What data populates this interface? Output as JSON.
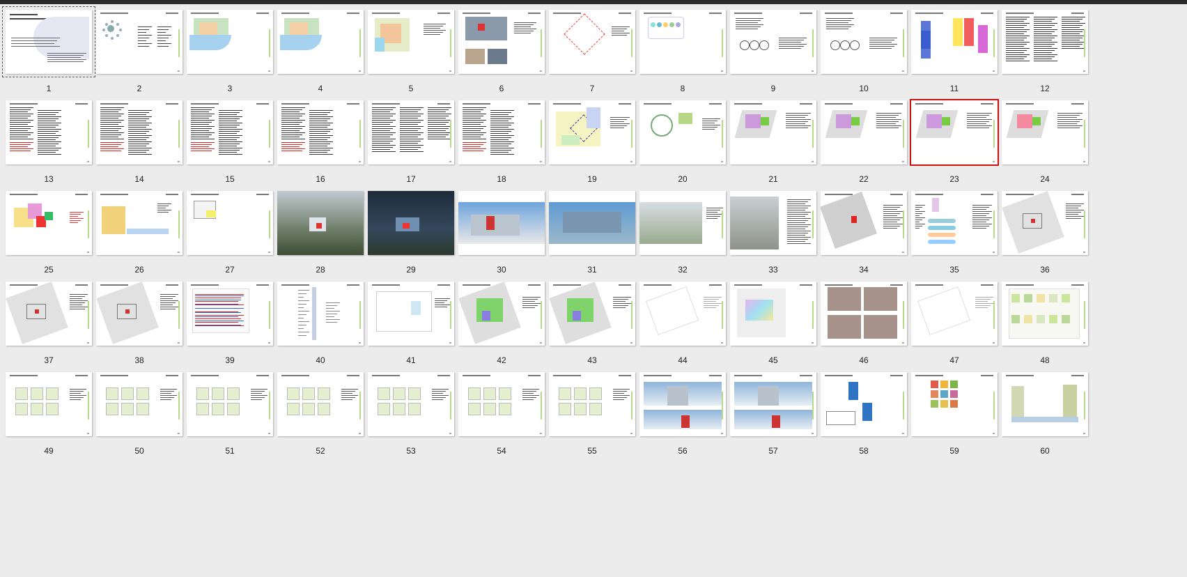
{
  "window": {
    "toolbar_color": "#2b2b2b",
    "background": "#ececec"
  },
  "selection": {
    "selected_slide": 23,
    "current_slide": 1,
    "selected_border_color": "#d01010"
  },
  "slides": [
    {
      "n": "1",
      "kind": "title"
    },
    {
      "n": "2",
      "kind": "hub"
    },
    {
      "n": "3",
      "kind": "map"
    },
    {
      "n": "4",
      "kind": "map2"
    },
    {
      "n": "5",
      "kind": "plan-color"
    },
    {
      "n": "6",
      "kind": "photos"
    },
    {
      "n": "7",
      "kind": "diamond"
    },
    {
      "n": "8",
      "kind": "circles"
    },
    {
      "n": "9",
      "kind": "diagram"
    },
    {
      "n": "10",
      "kind": "diagram"
    },
    {
      "n": "11",
      "kind": "flow"
    },
    {
      "n": "12",
      "kind": "text"
    },
    {
      "n": "13",
      "kind": "text-red"
    },
    {
      "n": "14",
      "kind": "text-red"
    },
    {
      "n": "15",
      "kind": "text-red"
    },
    {
      "n": "16",
      "kind": "text-red"
    },
    {
      "n": "17",
      "kind": "text"
    },
    {
      "n": "18",
      "kind": "text-red"
    },
    {
      "n": "19",
      "kind": "site"
    },
    {
      "n": "20",
      "kind": "circle-plan"
    },
    {
      "n": "21",
      "kind": "iso"
    },
    {
      "n": "22",
      "kind": "iso"
    },
    {
      "n": "23",
      "kind": "iso"
    },
    {
      "n": "24",
      "kind": "iso-pink"
    },
    {
      "n": "25",
      "kind": "massing"
    },
    {
      "n": "26",
      "kind": "elevation"
    },
    {
      "n": "27",
      "kind": "massing-light"
    },
    {
      "n": "28",
      "kind": "aerial"
    },
    {
      "n": "29",
      "kind": "aerial-dark"
    },
    {
      "n": "30",
      "kind": "render-blue"
    },
    {
      "n": "31",
      "kind": "render-glass"
    },
    {
      "n": "32",
      "kind": "render-site"
    },
    {
      "n": "33",
      "kind": "render-interior"
    },
    {
      "n": "34",
      "kind": "plan-selected"
    },
    {
      "n": "35",
      "kind": "pink-diagram"
    },
    {
      "n": "36",
      "kind": "plan-grey"
    },
    {
      "n": "37",
      "kind": "plan-grey"
    },
    {
      "n": "38",
      "kind": "plan-grey"
    },
    {
      "n": "39",
      "kind": "plan-redblue"
    },
    {
      "n": "40",
      "kind": "section"
    },
    {
      "n": "41",
      "kind": "plan-light"
    },
    {
      "n": "42",
      "kind": "plan-green"
    },
    {
      "n": "43",
      "kind": "plan-green"
    },
    {
      "n": "44",
      "kind": "plan-faint"
    },
    {
      "n": "45",
      "kind": "plan-pastel"
    },
    {
      "n": "46",
      "kind": "photos-brown"
    },
    {
      "n": "47",
      "kind": "plan-faint"
    },
    {
      "n": "48",
      "kind": "plan-colorful"
    },
    {
      "n": "49",
      "kind": "plan-small"
    },
    {
      "n": "50",
      "kind": "plan-small"
    },
    {
      "n": "51",
      "kind": "plan-small"
    },
    {
      "n": "52",
      "kind": "plan-small"
    },
    {
      "n": "53",
      "kind": "plan-small"
    },
    {
      "n": "54",
      "kind": "plan-small"
    },
    {
      "n": "55",
      "kind": "plan-small"
    },
    {
      "n": "56",
      "kind": "elevation-blue"
    },
    {
      "n": "57",
      "kind": "elevation-blue"
    },
    {
      "n": "58",
      "kind": "blue-panel"
    },
    {
      "n": "59",
      "kind": "icons"
    },
    {
      "n": "60",
      "kind": "elevation-tall"
    }
  ]
}
